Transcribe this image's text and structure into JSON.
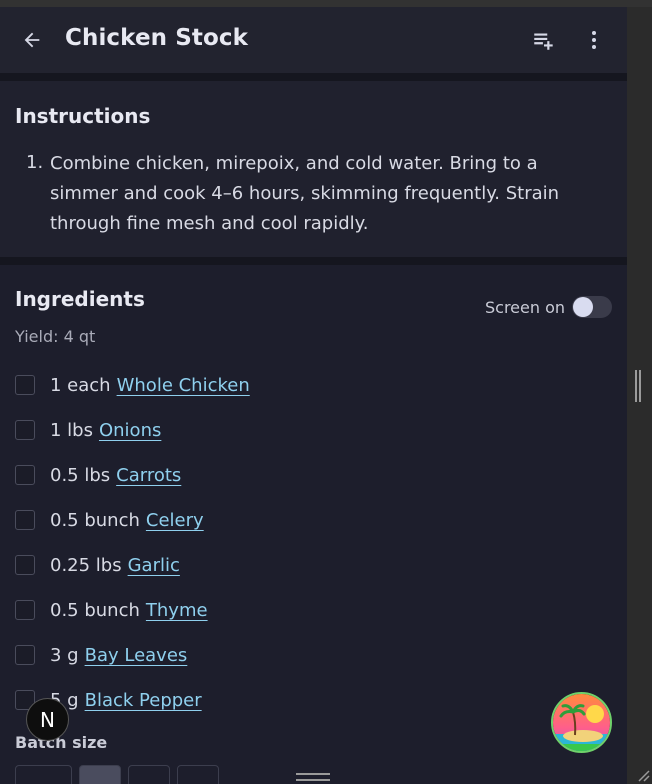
{
  "app": {
    "title": "Chicken Stock",
    "icons": {
      "back": "back-arrow-icon",
      "add_to_list": "playlist-add-icon",
      "more": "more-vert-icon"
    }
  },
  "instructions": {
    "heading": "Instructions",
    "steps": [
      {
        "number": "1.",
        "text": "Combine chicken, mirepoix, and cold water. Bring to a simmer and cook 4–6 hours, skimming frequently. Strain through fine mesh and cool rapidly."
      }
    ]
  },
  "ingredients": {
    "heading": "Ingredients",
    "yield": "Yield: 4 qt",
    "screen_toggle_label": "Screen on",
    "screen_toggle_on": false,
    "items": [
      {
        "qty": "1 each",
        "name": "Whole Chicken"
      },
      {
        "qty": "1 lbs",
        "name": "Onions"
      },
      {
        "qty": "0.5 lbs",
        "name": "Carrots"
      },
      {
        "qty": "0.5 bunch",
        "name": "Celery"
      },
      {
        "qty": "0.25 lbs",
        "name": "Garlic"
      },
      {
        "qty": "0.5 bunch",
        "name": "Thyme"
      },
      {
        "qty": "3 g",
        "name": "Bay Leaves"
      },
      {
        "qty": "5 g",
        "name": "Black Pepper"
      }
    ],
    "batch_label": "Batch size"
  },
  "overlay": {
    "dev_badge_letter": "N"
  },
  "colors": {
    "background": "#1d1e2c",
    "link": "#8fd0ee",
    "text": "#d8dae4"
  }
}
